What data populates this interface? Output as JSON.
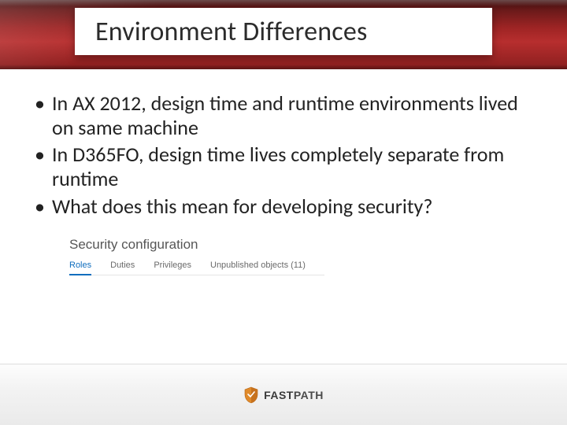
{
  "slide": {
    "title": "Environment Differences",
    "bullets": [
      "In AX 2012, design time and runtime environments lived on same machine",
      "In D365FO, design time lives completely separate from runtime",
      "What does this mean for developing security?"
    ]
  },
  "security_panel": {
    "heading": "Security configuration",
    "tabs": [
      {
        "label": "Roles",
        "active": true
      },
      {
        "label": "Duties",
        "active": false
      },
      {
        "label": "Privileges",
        "active": false
      },
      {
        "label": "Unpublished objects (11)",
        "active": false
      }
    ]
  },
  "footer": {
    "brand_bold": "FAST",
    "brand_light": "PATH"
  }
}
